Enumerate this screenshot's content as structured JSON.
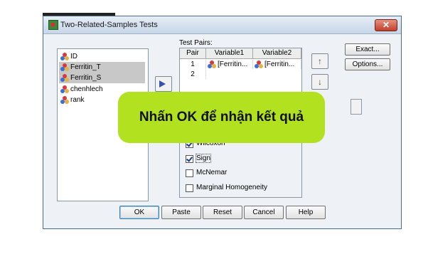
{
  "window": {
    "title": "Two-Related-Samples Tests",
    "close_glyph": "✕"
  },
  "variables": [
    {
      "name": "ID",
      "selected": false
    },
    {
      "name": "Ferritin_T",
      "selected": true
    },
    {
      "name": "Ferritin_S",
      "selected": true
    },
    {
      "name": "chenhlech",
      "selected": false
    },
    {
      "name": "rank",
      "selected": false
    }
  ],
  "test_pairs": {
    "label": "Test Pairs:",
    "columns": [
      "Pair",
      "Variable1",
      "Variable2"
    ],
    "rows": [
      {
        "pair": "1",
        "variable1": "[Ferritin...",
        "variable2": "[Ferritin..."
      },
      {
        "pair": "2",
        "variable1": "",
        "variable2": ""
      }
    ]
  },
  "side_buttons": {
    "exact": "Exact...",
    "options": "Options..."
  },
  "test_type": {
    "items": [
      {
        "label": "Wilcoxon",
        "checked": true
      },
      {
        "label": "Sign",
        "checked": true
      },
      {
        "label": "McNemar",
        "checked": false
      },
      {
        "label": "Marginal Homogeneity",
        "checked": false
      }
    ]
  },
  "buttons": {
    "ok": "OK",
    "paste": "Paste",
    "reset": "Reset",
    "cancel": "Cancel",
    "help": "Help"
  },
  "overlay": {
    "text": "Nhấn OK để nhận kết quả",
    "color": "#b1e11f"
  },
  "icons": {
    "move": "right-arrow-icon",
    "up": "up-arrow-icon",
    "down": "down-arrow-icon",
    "variable": "scale-variable-icon"
  }
}
